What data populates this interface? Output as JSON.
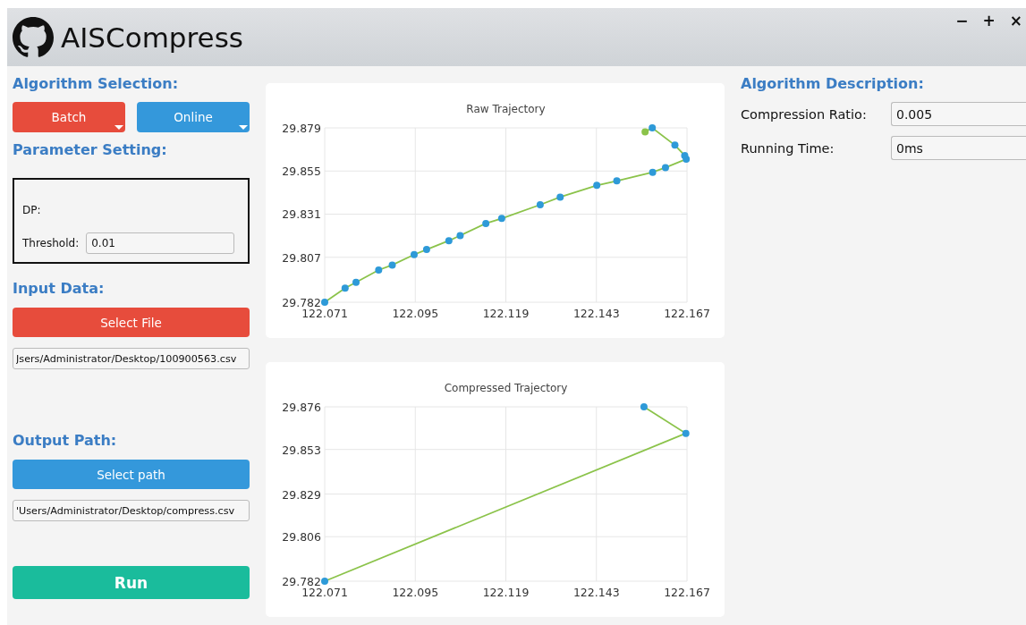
{
  "window": {
    "title": "AISCompress",
    "controls": [
      "−",
      "+",
      "×"
    ]
  },
  "algorithm_selection": {
    "heading": "Algorithm Selection:",
    "options": [
      {
        "label": "Batch",
        "color": "#e74c3c"
      },
      {
        "label": "Online",
        "color": "#3498db"
      }
    ]
  },
  "parameter_setting": {
    "heading": "Parameter Setting:",
    "method": "DP:",
    "threshold_label": "Threshold:",
    "threshold_value": "0.01"
  },
  "input_data": {
    "heading": "Input Data:",
    "button": "Select File",
    "path": "Jsers/Administrator/Desktop/100900563.csv"
  },
  "output_path": {
    "heading": "Output Path:",
    "button": "Select path",
    "path": "'Users/Administrator/Desktop/compress.csv"
  },
  "run_button": "Run",
  "charts": [
    {
      "chart_data": {
        "type": "line",
        "title": "Raw Trajectory",
        "x": [
          122.071,
          122.0764,
          122.0793,
          122.0853,
          122.0889,
          122.0947,
          122.098,
          122.1039,
          122.1069,
          122.1137,
          122.1179,
          122.1281,
          122.1334,
          122.1431,
          122.1484,
          122.1579,
          122.1613,
          122.1668,
          122.1664,
          122.1638,
          122.1578,
          122.1559
        ],
        "grid": true,
        "series": [
          {
            "color": "#8bc34a",
            "marker": true,
            "values": [
              29.782,
              29.7898,
              29.7931,
              29.7999,
              29.8027,
              29.8085,
              29.8113,
              29.8162,
              29.8191,
              29.8258,
              29.8286,
              29.8362,
              29.8405,
              29.847,
              29.8495,
              29.8543,
              29.8569,
              29.8616,
              29.8636,
              29.8694,
              29.879,
              29.8768
            ]
          }
        ],
        "xlim": [
          122.071,
          122.167
        ],
        "ylim": [
          29.782,
          29.879
        ],
        "xticks": [
          {
            "value": 122.071,
            "label": "122.071"
          },
          {
            "value": 122.095,
            "label": "122.095"
          },
          {
            "value": 122.119,
            "label": "122.119"
          },
          {
            "value": 122.143,
            "label": "122.143"
          },
          {
            "value": 122.167,
            "label": "122.167"
          }
        ],
        "yticks": [
          {
            "value": 29.782,
            "label": "29.782"
          },
          {
            "value": 29.807,
            "label": "29.807"
          },
          {
            "value": 29.831,
            "label": "29.831"
          },
          {
            "value": 29.855,
            "label": "29.855"
          },
          {
            "value": 29.879,
            "label": "29.879"
          }
        ]
      }
    },
    {
      "chart_data": {
        "type": "line",
        "title": "Compressed Trajectory",
        "x": [
          122.071,
          122.1667,
          122.1556
        ],
        "grid": true,
        "series": [
          {
            "color": "#8bc34a",
            "marker": true,
            "values": [
              29.782,
              29.8617,
              29.876
            ]
          }
        ],
        "xlim": [
          122.071,
          122.167
        ],
        "ylim": [
          29.782,
          29.876
        ],
        "xticks": [
          {
            "value": 122.071,
            "label": "122.071"
          },
          {
            "value": 122.095,
            "label": "122.095"
          },
          {
            "value": 122.119,
            "label": "122.119"
          },
          {
            "value": 122.143,
            "label": "122.143"
          },
          {
            "value": 122.167,
            "label": "122.167"
          }
        ],
        "yticks": [
          {
            "value": 29.782,
            "label": "29.782"
          },
          {
            "value": 29.806,
            "label": "29.806"
          },
          {
            "value": 29.829,
            "label": "29.829"
          },
          {
            "value": 29.853,
            "label": "29.853"
          },
          {
            "value": 29.876,
            "label": "29.876"
          }
        ]
      }
    }
  ],
  "algorithm_description": {
    "heading": "Algorithm Description:",
    "fields": [
      {
        "label": "Compression Ratio:",
        "value": "0.005"
      },
      {
        "label": "Running Time:",
        "value": "0ms"
      }
    ]
  }
}
